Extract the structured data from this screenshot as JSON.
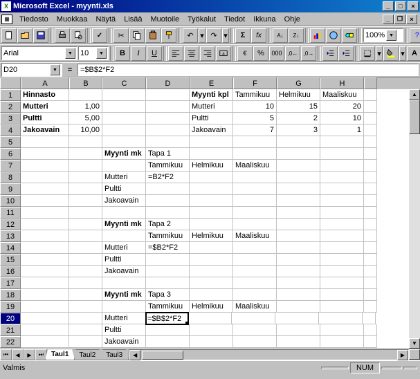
{
  "app": {
    "title": "Microsoft Excel - myynti.xls"
  },
  "menu": [
    "Tiedosto",
    "Muokkaa",
    "Näytä",
    "Lisää",
    "Muotoile",
    "Työkalut",
    "Tiedot",
    "Ikkuna",
    "Ohje"
  ],
  "format": {
    "font": "Arial",
    "size": "10",
    "zoom": "100%"
  },
  "formulabar": {
    "cellref": "D20",
    "formula": "=$B$2*F2"
  },
  "columns": [
    "A",
    "B",
    "C",
    "D",
    "E",
    "F",
    "G",
    "H",
    ""
  ],
  "rows": [
    "1",
    "2",
    "3",
    "4",
    "5",
    "6",
    "7",
    "8",
    "9",
    "10",
    "11",
    "12",
    "13",
    "14",
    "15",
    "16",
    "17",
    "18",
    "19",
    "20",
    "21",
    "22"
  ],
  "cells": {
    "A1": "Hinnasto",
    "E1": "Myynti kpl",
    "F1": "Tammikuu",
    "G1": "Helmikuu",
    "H1": "Maaliskuu",
    "A2": "Mutteri",
    "B2": "1,00",
    "E2": "Mutteri",
    "F2": "10",
    "G2": "15",
    "H2": "20",
    "A3": "Pultti",
    "B3": "5,00",
    "E3": "Pultti",
    "F3": "5",
    "G3": "2",
    "H3": "10",
    "A4": "Jakoavain",
    "B4": "10,00",
    "E4": "Jakoavain",
    "F4": "7",
    "G4": "3",
    "H4": "1",
    "C6": "Myynti mk",
    "D6": "Tapa 1",
    "D7": "Tammikuu",
    "E7": "Helmikuu",
    "F7": "Maaliskuu",
    "C8": "Mutteri",
    "D8": "=B2*F2",
    "C9": "Pultti",
    "C10": "Jakoavain",
    "C12": "Myynti mk",
    "D12": "Tapa 2",
    "D13": "Tammikuu",
    "E13": "Helmikuu",
    "F13": "Maaliskuu",
    "C14": "Mutteri",
    "D14": "=$B2*F2",
    "C15": "Pultti",
    "C16": "Jakoavain",
    "C18": "Myynti mk",
    "D18": "Tapa 3",
    "D19": "Tammikuu",
    "E19": "Helmikuu",
    "F19": "Maaliskuu",
    "C20": "Mutteri",
    "D20": "=$B$2*F2",
    "C21": "Pultti",
    "C22": "Jakoavain"
  },
  "bold_cells": [
    "A1",
    "A2",
    "A3",
    "A4",
    "E1",
    "C6",
    "C12",
    "C18"
  ],
  "right_cells": [
    "B2",
    "B3",
    "B4",
    "F2",
    "G2",
    "H2",
    "F3",
    "G3",
    "H3",
    "F4",
    "G4",
    "H4"
  ],
  "active_cell": "D20",
  "tabs": {
    "active": "Taul1",
    "others": [
      "Taul2",
      "Taul3"
    ]
  },
  "status": {
    "ready": "Valmis",
    "num": "NUM"
  }
}
